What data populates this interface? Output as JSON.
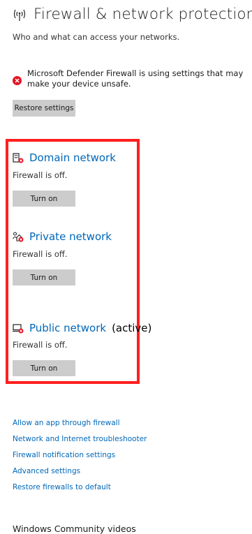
{
  "header": {
    "title": "Firewall & network protection",
    "subtitle": "Who and what can access your networks.",
    "icon": "wireless-signal-icon"
  },
  "warning": {
    "icon": "error-circle-icon",
    "text": "Microsoft Defender Firewall is using settings that may make your device unsafe.",
    "color": "#e81123"
  },
  "restore_button": {
    "label": "Restore settings"
  },
  "networks": [
    {
      "icon": "domain-network-icon",
      "title": "Domain network",
      "active_label": "",
      "status": "Firewall is off.",
      "button_label": "Turn on"
    },
    {
      "icon": "private-network-icon",
      "title": "Private network",
      "active_label": "",
      "status": "Firewall is off.",
      "button_label": "Turn on"
    },
    {
      "icon": "public-network-icon",
      "title": "Public network",
      "active_label": "(active)",
      "status": "Firewall is off.",
      "button_label": "Turn on"
    }
  ],
  "links": [
    "Allow an app through firewall",
    "Network and Internet troubleshooter",
    "Firewall notification settings",
    "Advanced settings",
    "Restore firewalls to default"
  ],
  "community": {
    "title": "Windows Community videos"
  },
  "colors": {
    "accent": "#0067b8",
    "highlight": "#ff1f1f",
    "button": "#cccccc",
    "error": "#e81123"
  }
}
